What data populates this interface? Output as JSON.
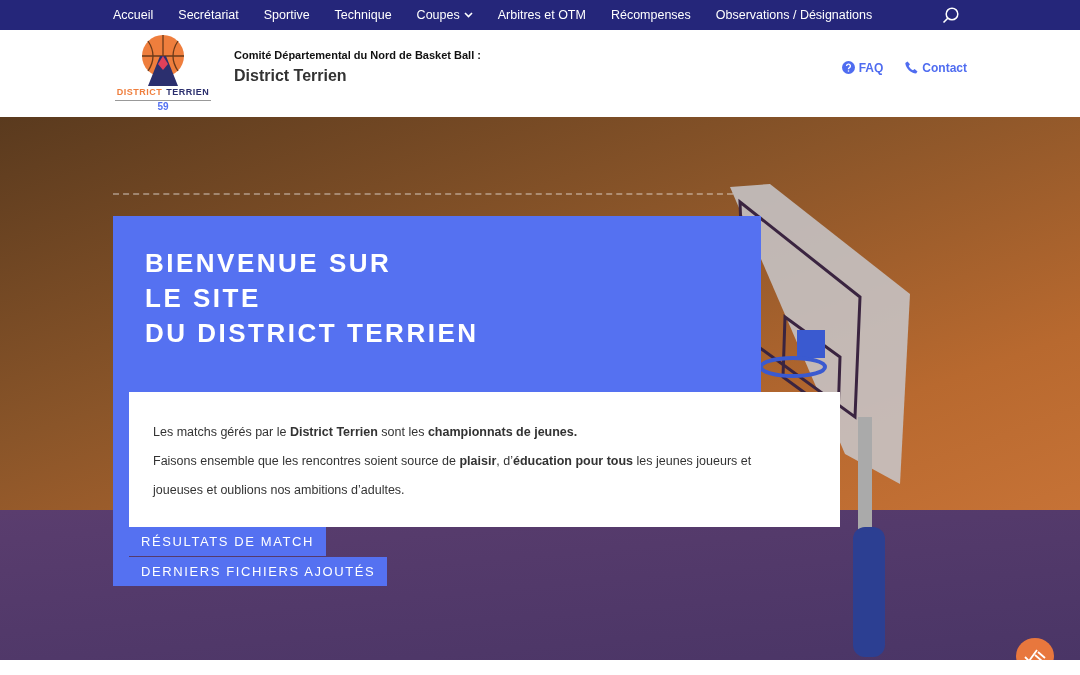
{
  "nav": {
    "items": [
      {
        "label": "Accueil",
        "kind": "link"
      },
      {
        "label": "Secrétariat",
        "kind": "link"
      },
      {
        "label": "Sportive",
        "kind": "link"
      },
      {
        "label": "Technique",
        "kind": "link"
      },
      {
        "label": "Coupes",
        "kind": "dropdown"
      },
      {
        "label": "Arbitres et OTM",
        "kind": "link"
      },
      {
        "label": "Récompenses",
        "kind": "link"
      },
      {
        "label": "Observations / Désignations",
        "kind": "link"
      }
    ]
  },
  "header": {
    "logo": {
      "word_1": "DISTRICT",
      "word_2": "TERRIEN",
      "number": "59"
    },
    "subtitle": "Comité Départemental du Nord de Basket Ball :",
    "title": "District Terrien",
    "links": [
      {
        "label": "FAQ",
        "kind": "help"
      },
      {
        "label": "Contact",
        "kind": "phone"
      }
    ]
  },
  "hero": {
    "heading": [
      "BIENVENUE SUR",
      "LE SITE",
      "DU DISTRICT TERRIEN"
    ],
    "paragraphs": [
      "Les matchs gérés par le **District Terrien** sont les **championnats de jeunes.**",
      "Faisons ensemble que les rencontres soient source de **plaisir**, d’**éducation pour tous** les jeunes joueurs et joueuses et oublions nos ambitions d’adultes."
    ],
    "buttons": [
      "RÉSULTATS DE MATCH",
      "DERNIERS FICHIERS AJOUTÉS"
    ]
  }
}
